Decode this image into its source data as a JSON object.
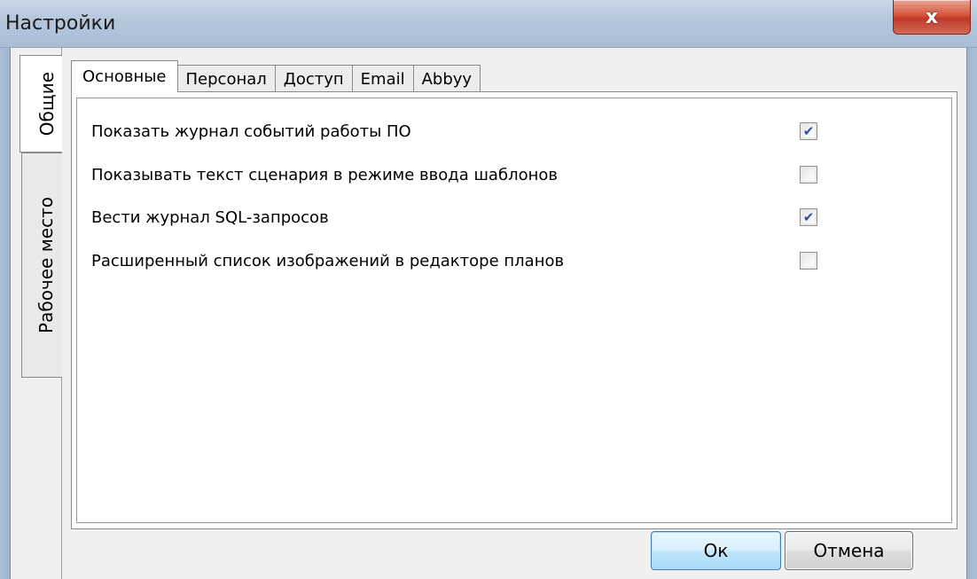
{
  "window": {
    "title": "Настройки",
    "close_label": "x"
  },
  "side_tabs": [
    {
      "label": "Общие",
      "active": true
    },
    {
      "label": "Рабочее место",
      "active": false
    }
  ],
  "tabs": [
    {
      "label": "Основные",
      "active": true
    },
    {
      "label": "Персонал",
      "active": false
    },
    {
      "label": "Доступ",
      "active": false
    },
    {
      "label": "Email",
      "active": false
    },
    {
      "label": "Abbyy",
      "active": false
    }
  ],
  "settings": [
    {
      "label": "Показать журнал событий работы ПО",
      "checked": true
    },
    {
      "label": "Показывать текст сценария в режиме ввода шаблонов",
      "checked": false
    },
    {
      "label": "Вести журнал SQL-запросов",
      "checked": true
    },
    {
      "label": "Расширенный список изображений в редакторе планов",
      "checked": false
    }
  ],
  "buttons": {
    "ok_label": "Ок",
    "cancel_label": "Отмена"
  },
  "colors": {
    "check_tick": "#2b4e9f",
    "ok_border": "#3c7fb1",
    "close_red": "#c0392b"
  }
}
